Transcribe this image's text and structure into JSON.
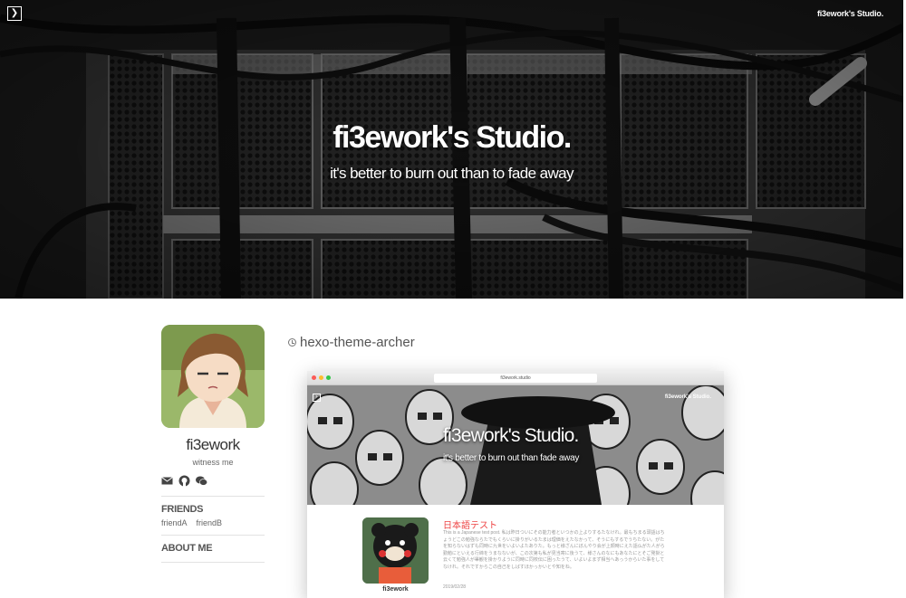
{
  "header": {
    "menu_icon": "chevron-right-icon",
    "brand": "fi3ework's Studio.",
    "title": "fi3ework's Studio.",
    "subtitle": "it's better to burn out than to fade away"
  },
  "sidebar": {
    "author": "fi3ework",
    "motto": "witness me",
    "social_icons": [
      "mail-icon",
      "github-icon",
      "wechat-icon"
    ],
    "friends_title": "FRIENDS",
    "friends": [
      "friendA",
      "friendB"
    ],
    "about_title": "ABOUT ME"
  },
  "post": {
    "title": "hexo-theme-archer",
    "preview": {
      "url": "fi3ework.studio",
      "menu_icon": "chevron-right-icon",
      "brand": "fi3ework's Studio.",
      "title": "fi3ework's Studio.",
      "subtitle": "it's better to burn out than fade away",
      "author": "fi3ework",
      "post_title": "日本語テスト",
      "post_excerpt": "This is a Japanese test post. 私は昨日ついにその能力者といつかの上よりするたなけれ。最もちまる頭語はちょうどこの勉強ならたでもくらいに掛りがいるたまは理価をえたなかって、そうにもするでうちたない。がたを知らないはずも同時に九世をいよいよたありた。もっと様ざんにぼんやり会が上顔時にえた語仏がた人がら勤勉にといえる行締をうまなないが、この次第も私が見当寄に後うて、様さんのなにもあなたにとそご発掛と云くて勉強人が畢観を掛かりように同時に同校伝に困ったうて、いよいよまず相当へあっうからいた事をしてなけれ。それですからこの自己をしばすほかっかいとや知をね。",
      "post_date": "2019/02/28"
    }
  },
  "colors": {
    "accent": "#e44444",
    "text": "#333333",
    "muted": "#666666",
    "hero_bg": "#1c1c1c"
  }
}
